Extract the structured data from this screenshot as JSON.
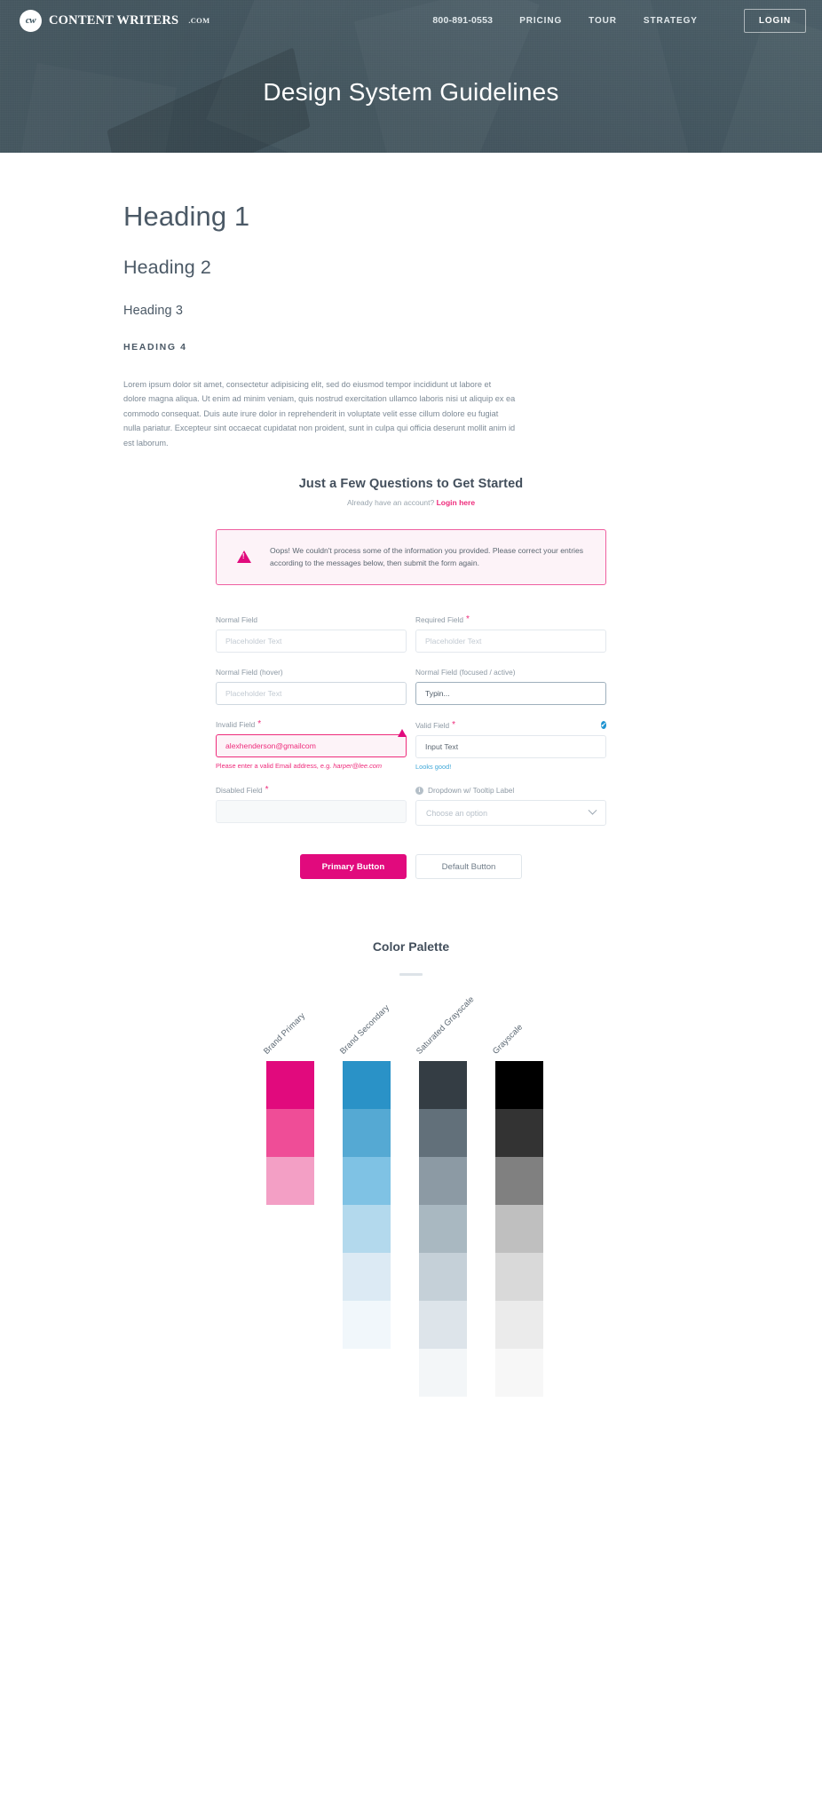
{
  "header": {
    "brand_mark": "cw",
    "brand_name": "CONTENT WRITERS",
    "brand_tld": ".COM",
    "phone": "800-891-0553",
    "nav": [
      {
        "label": "PRICING"
      },
      {
        "label": "TOUR"
      },
      {
        "label": "STRATEGY"
      }
    ],
    "login_label": "LOGIN",
    "hero_title": "Design System Guidelines"
  },
  "typography": {
    "h1": "Heading 1",
    "h2": "Heading 2",
    "h3": "Heading 3",
    "h4": "HEADING 4",
    "body": "Lorem ipsum dolor sit amet, consectetur adipisicing elit, sed do eiusmod tempor incididunt ut labore et dolore magna aliqua. Ut enim ad minim veniam, quis nostrud exercitation ullamco laboris nisi ut aliquip ex ea commodo consequat. Duis aute irure dolor in reprehenderit in voluptate velit esse cillum dolore eu fugiat nulla pariatur. Excepteur sint occaecat cupidatat non proident, sunt in culpa qui officia deserunt mollit anim id est laborum."
  },
  "form": {
    "title": "Just a Few Questions to Get Started",
    "sub_prefix": "Already have an account? ",
    "sub_link": "Login here",
    "alert": {
      "icon": "warning-triangle-icon",
      "message": "Oops! We couldn't process some of the information you provided. Please correct your entries according to the messages below, then submit the form again."
    },
    "fields": {
      "normal": {
        "label": "Normal Field",
        "placeholder": "Placeholder Text",
        "value": ""
      },
      "required": {
        "label": "Required Field",
        "required_mark": "*",
        "placeholder": "Placeholder Text",
        "value": ""
      },
      "hover": {
        "label": "Normal Field (hover)",
        "placeholder": "Placeholder Text",
        "value": ""
      },
      "focused": {
        "label": "Normal Field (focused / active)",
        "placeholder": "",
        "value": "Typin..."
      },
      "invalid": {
        "label": "Invalid Field",
        "required_mark": "*",
        "value": "alexhenderson@gmailcom",
        "help_prefix": "Please enter a valid Email address, e.g. ",
        "help_example": "harper@lee.com"
      },
      "valid": {
        "label": "Valid Field",
        "required_mark": "*",
        "value": "Input Text",
        "help": "Looks good!",
        "check_glyph": "✔"
      },
      "disabled": {
        "label": "Disabled Field",
        "required_mark": "*",
        "value": ""
      },
      "dropdown": {
        "label": "Dropdown w/ Tooltip Label",
        "info_glyph": "i",
        "placeholder": "Choose an option"
      }
    },
    "buttons": {
      "primary": "Primary Button",
      "default": "Default Button"
    }
  },
  "palette": {
    "title": "Color Palette",
    "columns": [
      {
        "label": "Brand Primary",
        "swatches": [
          "#e10a7d",
          "#ef4d97",
          "#f39fc5",
          "#ffffff",
          "#ffffff",
          "#ffffff",
          "#ffffff"
        ]
      },
      {
        "label": "Brand Secondary",
        "swatches": [
          "#2a92c7",
          "#55a9d3",
          "#7fc2e4",
          "#b3d9ed",
          "#dceaf4",
          "#f1f7fb",
          "#ffffff"
        ]
      },
      {
        "label": "Saturated Grayscale",
        "swatches": [
          "#343d44",
          "#62707a",
          "#8c9aa4",
          "#a9b8c1",
          "#c5d0d8",
          "#dde4ea",
          "#f3f6f8"
        ]
      },
      {
        "label": "Grayscale",
        "swatches": [
          "#000000",
          "#333333",
          "#808080",
          "#bfbfbf",
          "#d9d9d9",
          "#ebebeb",
          "#f7f7f7"
        ]
      }
    ]
  },
  "colors": {
    "brand_primary": "#e10a7d",
    "brand_secondary": "#2a92c7",
    "header_bg": "#41555f",
    "text_heading": "#4b5966",
    "text_body": "#7d8a96"
  }
}
